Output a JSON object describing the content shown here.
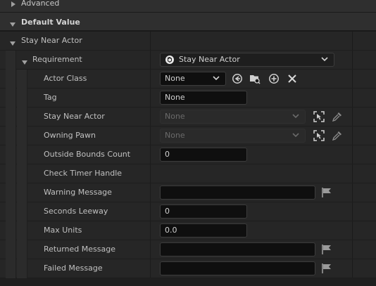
{
  "sections": {
    "advanced": "Advanced",
    "default_value": "Default Value"
  },
  "tree": {
    "stay_near_actor": "Stay Near Actor",
    "requirement": "Requirement",
    "requirement_value": "Stay Near Actor"
  },
  "properties": {
    "actor_class": {
      "label": "Actor Class",
      "value": "None"
    },
    "tag": {
      "label": "Tag",
      "value": "None"
    },
    "stay_near_actor": {
      "label": "Stay Near Actor",
      "value": "None"
    },
    "owning_pawn": {
      "label": "Owning Pawn",
      "value": "None"
    },
    "outside_bounds_count": {
      "label": "Outside Bounds Count",
      "value": "0"
    },
    "check_timer_handle": {
      "label": "Check Timer Handle"
    },
    "warning_message": {
      "label": "Warning Message",
      "value": ""
    },
    "seconds_leeway": {
      "label": "Seconds Leeway",
      "value": "0"
    },
    "max_units": {
      "label": "Max Units",
      "value": "0.0"
    },
    "returned_message": {
      "label": "Returned Message",
      "value": ""
    },
    "failed_message": {
      "label": "Failed Message",
      "value": ""
    }
  },
  "icons": {
    "use_selected": "use-selected-icon",
    "browse": "browse-icon",
    "add": "add-icon",
    "clear": "clear-icon",
    "pick_actor": "pick-actor-icon",
    "eyedropper": "eyedropper-icon",
    "localize_flag": "flag-icon"
  },
  "colors": {
    "panel_bg": "#262626",
    "field_bg": "#0f0f0f",
    "header_bg": "#2f2f2f"
  }
}
